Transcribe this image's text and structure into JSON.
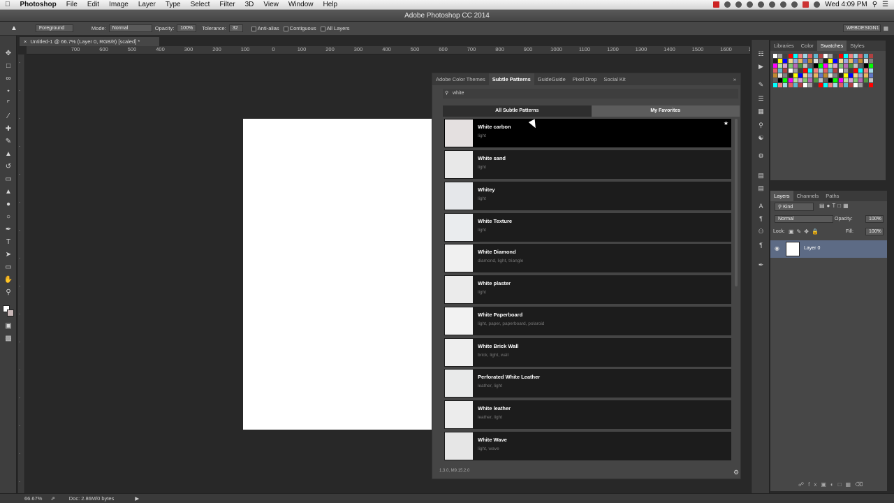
{
  "menubar": {
    "app": "Photoshop",
    "items": [
      "File",
      "Edit",
      "Image",
      "Layer",
      "Type",
      "Select",
      "Filter",
      "3D",
      "View",
      "Window",
      "Help"
    ],
    "clock": "Wed 4:09 PM"
  },
  "window": {
    "title": "Adobe Photoshop CC 2014"
  },
  "options": {
    "foreground": "Foreground",
    "mode_label": "Mode:",
    "mode_value": "Normal",
    "opacity_label": "Opacity:",
    "opacity_value": "100%",
    "tolerance_label": "Tolerance:",
    "tolerance_value": "32",
    "antialias": "Anti-alias",
    "contiguous": "Contiguous",
    "all_layers": "All Layers",
    "workspace": "WEBDESIGN1"
  },
  "document": {
    "tab": "Untitled-1 @ 66.7% (Layer 0, RGB/8) [scaled] *",
    "ruler_h": [
      "700",
      "600",
      "500",
      "400",
      "300",
      "200",
      "100",
      "0",
      "100",
      "200",
      "300",
      "400",
      "500",
      "600",
      "700",
      "800",
      "900",
      "1000",
      "1100",
      "1200",
      "1300",
      "1400",
      "1500",
      "1600",
      "1700"
    ]
  },
  "plugin": {
    "tabs": [
      "Adobe Color Themes",
      "Subtle Patterns",
      "GuideGuide",
      "Pixel Drop",
      "Social Kit"
    ],
    "active_tab": 1,
    "search_value": "white",
    "segments": [
      "All Subtle Patterns",
      "My Favorites"
    ],
    "footer": "1.3.0, M9.15.2.0",
    "patterns": [
      {
        "name": "White carbon",
        "tags": "light"
      },
      {
        "name": "White sand",
        "tags": "light"
      },
      {
        "name": "Whitey",
        "tags": "light"
      },
      {
        "name": "White Texture",
        "tags": "light"
      },
      {
        "name": "White Diamond",
        "tags": "diamond, light, triangle"
      },
      {
        "name": "White plaster",
        "tags": "light"
      },
      {
        "name": "White Paperboard",
        "tags": "light, paper, paperboard, polaroid"
      },
      {
        "name": "White Brick Wall",
        "tags": "brick, light, wall"
      },
      {
        "name": "Perforated White Leather",
        "tags": "leather, light"
      },
      {
        "name": "White leather",
        "tags": "leather, light"
      },
      {
        "name": "White Wave",
        "tags": "light, wave"
      }
    ],
    "star": "★"
  },
  "swatches_panel": {
    "tabs": [
      "Libraries",
      "Color",
      "Swatches",
      "Styles"
    ],
    "active_tab": 2
  },
  "layers_panel": {
    "tabs": [
      "Layers",
      "Channels",
      "Paths"
    ],
    "filter": "Kind",
    "blend": "Normal",
    "opacity_label": "Opacity:",
    "opacity_value": "100%",
    "lock_label": "Lock:",
    "fill_label": "Fill:",
    "fill_value": "100%",
    "layer_name": "Layer 0"
  },
  "status": {
    "zoom": "66.67%",
    "doc": "Doc: 2.86M/0 bytes"
  }
}
